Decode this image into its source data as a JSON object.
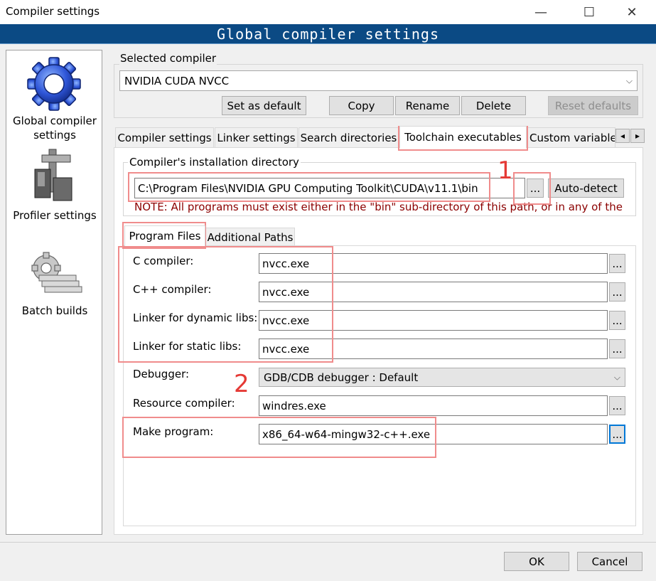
{
  "window": {
    "title": "Compiler settings",
    "minimize": "—",
    "maximize": "☐",
    "close": "✕"
  },
  "banner": "Global compiler settings",
  "sidebar": {
    "items": [
      {
        "label1": "Global compiler",
        "label2": "settings",
        "icon": "gear-icon"
      },
      {
        "label1": "Profiler settings",
        "icon": "caliper-icon"
      },
      {
        "label1": "Batch builds",
        "icon": "gears-stack-icon"
      }
    ]
  },
  "selected_compiler": {
    "label": "Selected compiler",
    "value": "NVIDIA CUDA NVCC"
  },
  "compiler_buttons": {
    "set_default": "Set as default",
    "copy": "Copy",
    "rename": "Rename",
    "delete": "Delete",
    "reset": "Reset defaults"
  },
  "tabs": [
    "Compiler settings",
    "Linker settings",
    "Search directories",
    "Toolchain executables",
    "Custom variable"
  ],
  "tab_scroll": {
    "left": "◂",
    "right": "▸"
  },
  "install_dir": {
    "label": "Compiler's installation directory",
    "value": "C:\\Program Files\\NVIDIA GPU Computing Toolkit\\CUDA\\v11.1\\bin",
    "browse": "...",
    "autodetect": "Auto-detect",
    "note": "NOTE: All programs must exist either in the \"bin\" sub-directory of this path, or in any of the"
  },
  "subtabs": [
    "Program Files",
    "Additional Paths"
  ],
  "programs": [
    {
      "label": "C compiler:",
      "value": "nvcc.exe"
    },
    {
      "label": "C++ compiler:",
      "value": "nvcc.exe"
    },
    {
      "label": "Linker for dynamic libs:",
      "value": "nvcc.exe"
    },
    {
      "label": "Linker for static libs:",
      "value": "nvcc.exe"
    },
    {
      "label": "Debugger:",
      "value": "GDB/CDB debugger : Default"
    },
    {
      "label": "Resource compiler:",
      "value": "windres.exe"
    },
    {
      "label": "Make program:",
      "value": "x86_64-w64-mingw32-c++.exe"
    }
  ],
  "browse_label": "...",
  "annotations": {
    "one": "1",
    "two": "2"
  },
  "footer": {
    "ok": "OK",
    "cancel": "Cancel"
  }
}
